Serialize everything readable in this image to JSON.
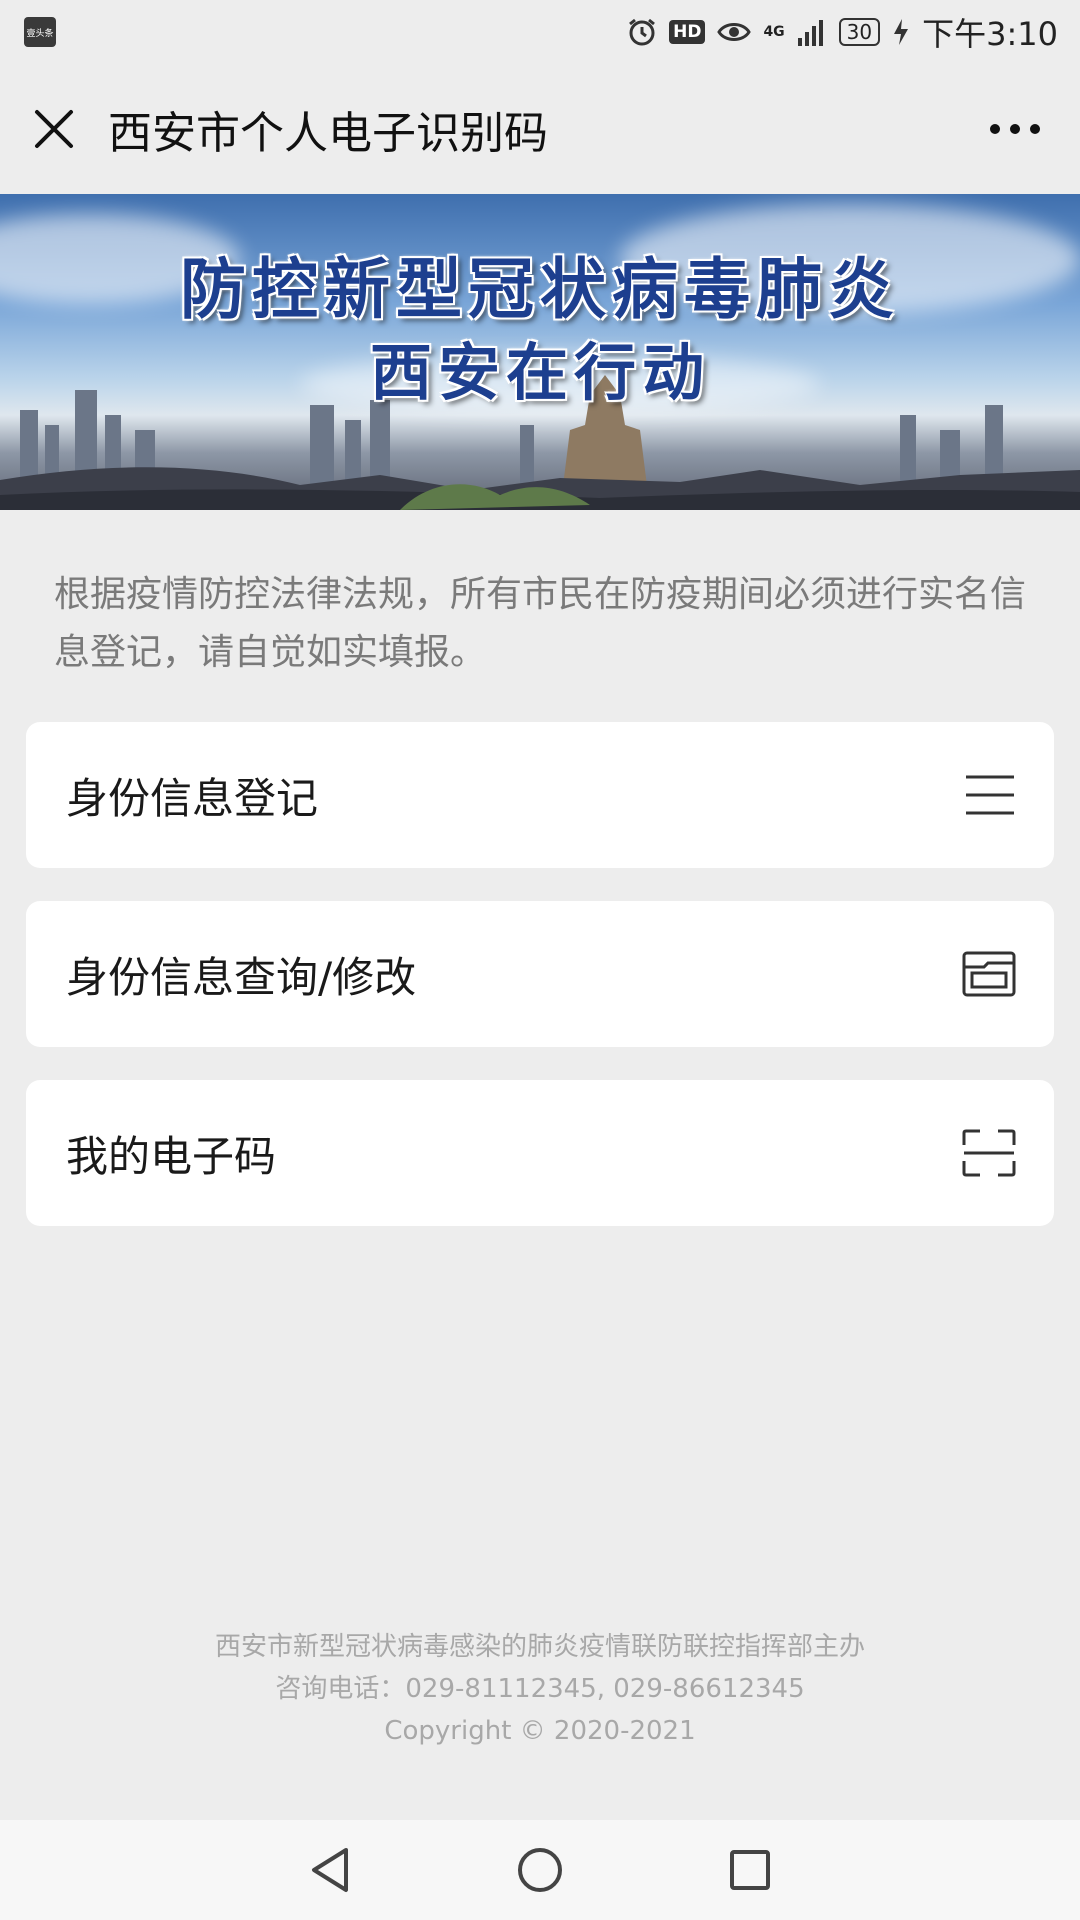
{
  "status_bar": {
    "app_icon_text": "壹头条",
    "hd_label": "HD",
    "network_label": "4G",
    "battery_level": "30",
    "time": "下午3:10"
  },
  "nav": {
    "title": "西安市个人电子识别码"
  },
  "banner": {
    "line1": "防控新型冠状病毒肺炎",
    "line2": "西安在行动"
  },
  "notice": "根据疫情防控法律法规，所有市民在防疫期间必须进行实名信息登记，请自觉如实填报。",
  "menu": [
    {
      "label": "身份信息登记",
      "icon": "list-icon"
    },
    {
      "label": "身份信息查询/修改",
      "icon": "id-card-icon"
    },
    {
      "label": "我的电子码",
      "icon": "scan-icon"
    }
  ],
  "footer": {
    "line1": "西安市新型冠状病毒感染的肺炎疫情联防联控指挥部主办",
    "line2": "咨询电话：029-81112345, 029-86612345",
    "line3": "Copyright © 2020-2021"
  }
}
